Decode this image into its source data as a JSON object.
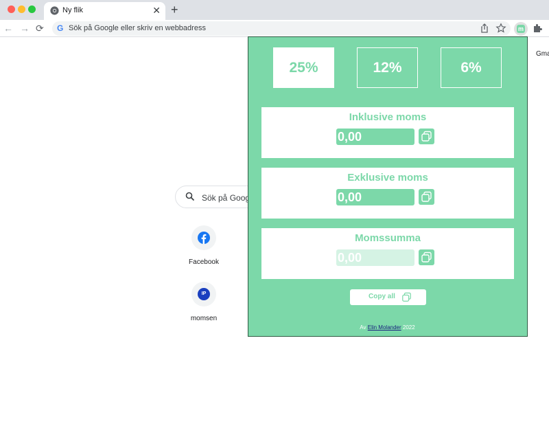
{
  "browser": {
    "tab_title": "Ny flik",
    "tab_close": "✕",
    "new_tab": "+",
    "omnibox_placeholder": "Sök på Google eller skriv en webbadress",
    "google_g": "G",
    "nav_back": "←",
    "nav_forward": "→",
    "nav_reload": "⟳"
  },
  "newtab_page": {
    "search_placeholder": "Sök på Goog",
    "gmail_link": "Gma",
    "shortcuts": [
      {
        "label": "Facebook",
        "icon": "facebook-icon",
        "color": "#1877f2"
      },
      {
        "label": "momsen",
        "icon": "ip-icon",
        "color": "#1a3fbf",
        "icon_text": "IP"
      }
    ]
  },
  "extension": {
    "icon_letter": "m",
    "rates": [
      {
        "label": "25%",
        "active": true
      },
      {
        "label": "12%",
        "active": false
      },
      {
        "label": "6%",
        "active": false
      }
    ],
    "fields": [
      {
        "title": "Inklusive moms",
        "value": "0,00",
        "readonly": false
      },
      {
        "title": "Exklusive moms",
        "value": "0,00",
        "readonly": false
      },
      {
        "title": "Momssumma",
        "value": "0,00",
        "readonly": true
      }
    ],
    "copy_all_label": "Copy all",
    "footer_prefix": "Av",
    "footer_author": "Elin Molander",
    "footer_year": "2022"
  },
  "colors": {
    "accent": "#7cd8a9",
    "accent_light": "#d5f3e4",
    "popup_border": "#2f5a43"
  }
}
